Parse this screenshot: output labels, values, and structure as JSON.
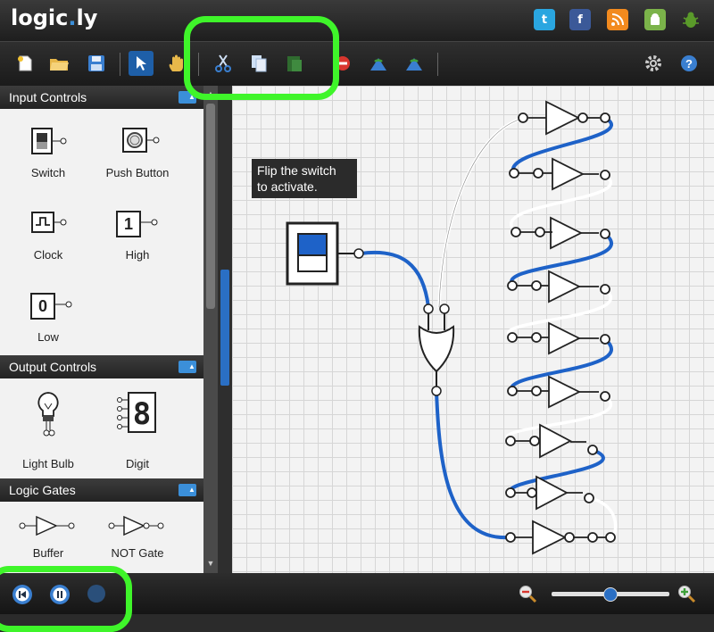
{
  "app": {
    "logo_main": "logic",
    "logo_dot": ".",
    "logo_end": "ly"
  },
  "social": {
    "twitter": "t",
    "facebook": "f",
    "rss": "rss",
    "android": "a",
    "bug": "bug"
  },
  "toolbar": {
    "buttons": [
      "new-file-icon",
      "open-folder-icon",
      "save-icon",
      "select-pointer-icon",
      "pan-hand-icon",
      "cut-icon",
      "copy-icon",
      "paste-icon",
      "delete-icon",
      "rotate-left-icon",
      "rotate-right-icon",
      "settings-gear-icon",
      "help-icon"
    ],
    "active": "select-pointer-icon"
  },
  "sidebar": {
    "input_controls": {
      "title": "Input Controls",
      "items": [
        {
          "label": "Switch"
        },
        {
          "label": "Push Button"
        },
        {
          "label": "Clock"
        },
        {
          "label": "High",
          "glyph": "1"
        },
        {
          "label": "Low",
          "glyph": "0"
        }
      ]
    },
    "output_controls": {
      "title": "Output Controls",
      "items": [
        {
          "label": "Light Bulb"
        },
        {
          "label": "Digit",
          "glyph": "8"
        }
      ]
    },
    "logic_gates": {
      "title": "Logic Gates",
      "items": [
        {
          "label": "Buffer"
        },
        {
          "label": "NOT Gate"
        }
      ]
    }
  },
  "canvas": {
    "tooltip_line1": "Flip the switch",
    "tooltip_line2": "to activate."
  },
  "bottom": {
    "controls": [
      "rewind-icon",
      "pause-icon",
      "step-icon"
    ],
    "zoom_level": 0.6
  },
  "colors": {
    "accent": "#1e62c8",
    "highlight": "#3ff52a",
    "wire_active": "#1e62c8",
    "wire_idle": "#ffffff"
  }
}
